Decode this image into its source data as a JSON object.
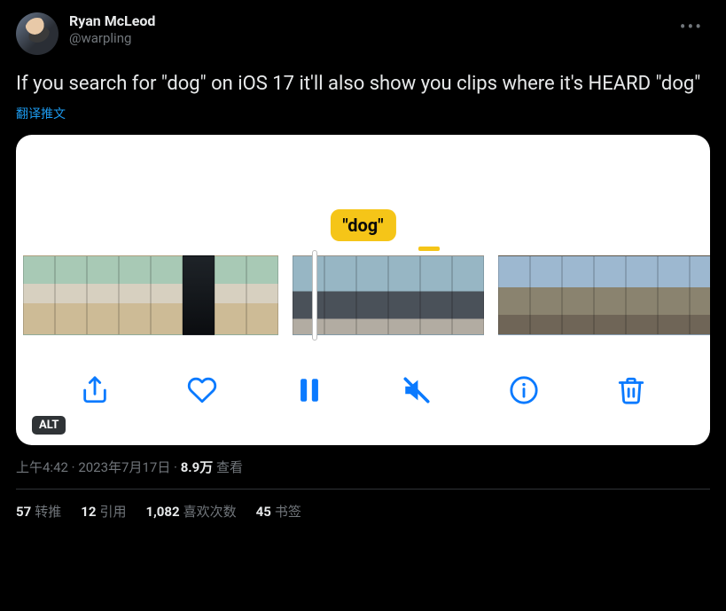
{
  "author": {
    "display_name": "Ryan McLeod",
    "handle": "@warpling"
  },
  "tweet": {
    "text": "If you search for \"dog\" on iOS 17 it'll also show you clips where it's HEARD \"dog\"",
    "translate_label": "翻译推文"
  },
  "media": {
    "tooltip": "\"dog\"",
    "alt_label": "ALT",
    "icons": {
      "share": "share-icon",
      "like": "heart-icon",
      "pause": "pause-icon",
      "mute": "mute-icon",
      "info": "info-icon",
      "delete": "trash-icon"
    }
  },
  "meta": {
    "time": "上午4:42",
    "date": "2023年7月17日",
    "views_value": "8.9万",
    "views_label": "查看",
    "separator": " · "
  },
  "stats": {
    "retweets": {
      "value": "57",
      "label": "转推"
    },
    "quotes": {
      "value": "12",
      "label": "引用"
    },
    "likes": {
      "value": "1,082",
      "label": "喜欢次数"
    },
    "bookmarks": {
      "value": "45",
      "label": "书签"
    }
  }
}
